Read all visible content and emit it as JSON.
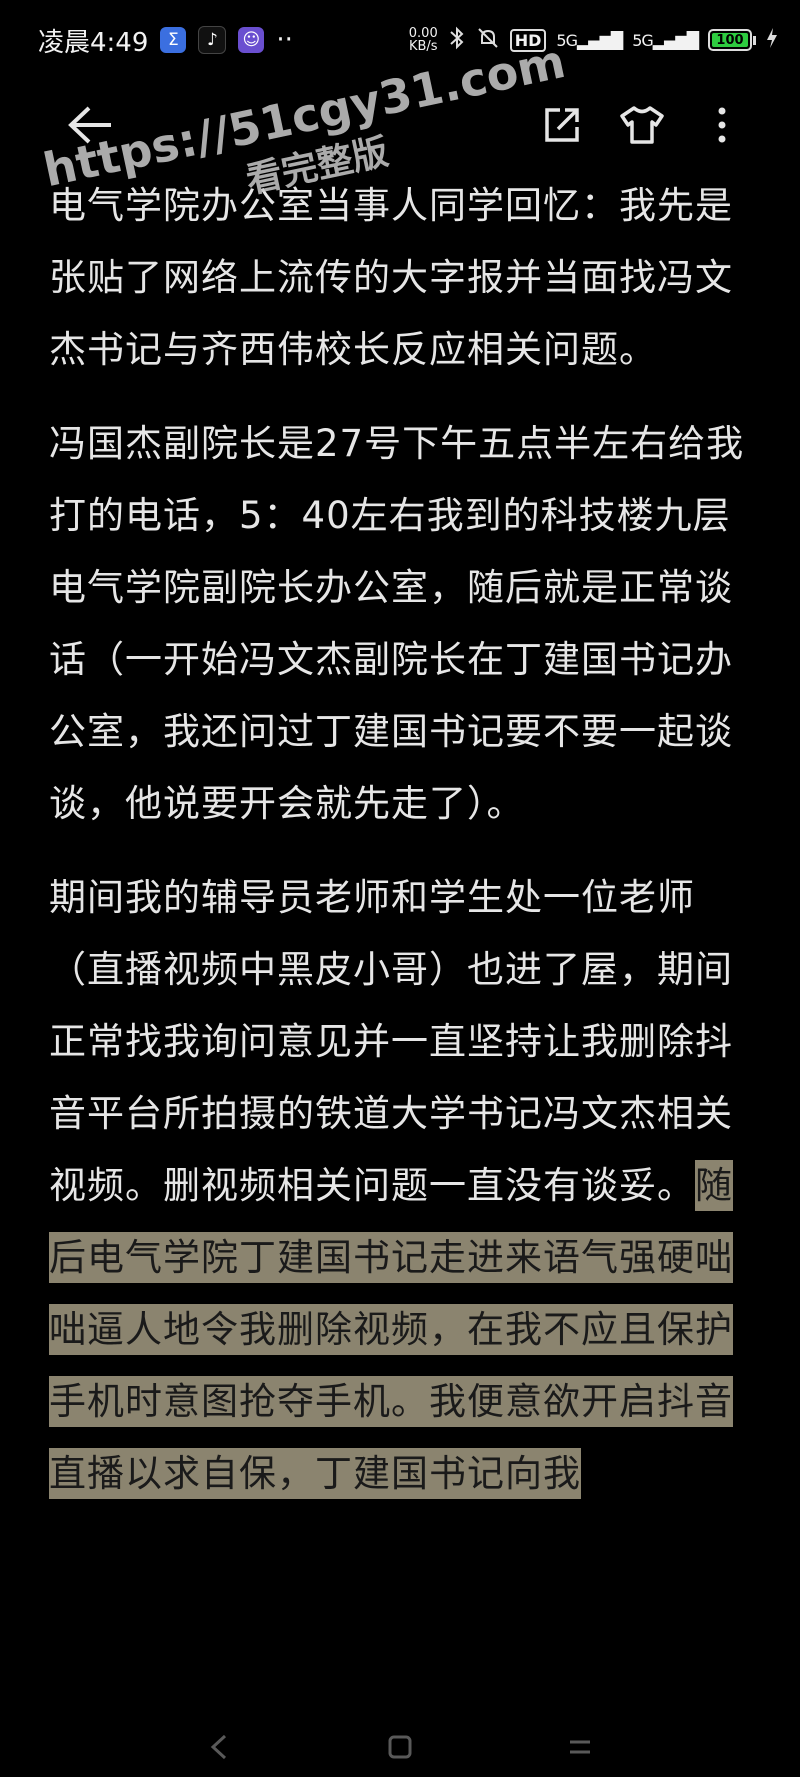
{
  "status_bar": {
    "time": "凌晨4:49",
    "app_icons": [
      "sigma-app-icon",
      "tiktok-icon",
      "app-icon"
    ],
    "more": "··",
    "net_speed_value": "0.00",
    "net_speed_unit": "KB/s",
    "hd_label": "HD",
    "signal1": "5G",
    "signal2": "5G",
    "battery_level": "100",
    "battery_percent": 100
  },
  "toolbar": {
    "back_icon": "back-arrow-icon",
    "share_icon": "share-icon",
    "theme_icon": "tshirt-icon",
    "more_icon": "more-vertical-icon"
  },
  "watermark": {
    "url": "https://51cgy31.com",
    "subtitle": "看完整版"
  },
  "article": {
    "p1": "电气学院办公室当事人同学回忆：我先是张贴了网络上流传的大字报并当面找冯文杰书记与齐西伟校长反应相关问题。",
    "p2": "冯国杰副院长是27号下午五点半左右给我打的电话，5：40左右我到的科技楼九层电气学院副院长办公室，随后就是正常谈话（一开始冯文杰副院长在丁建国书记办公室，我还问过丁建国书记要不要一起谈谈，他说要开会就先走了）。",
    "p3_plain": "期间我的辅导员老师和学生处一位老师（直播视频中黑皮小哥）也进了屋，期间正常找我询问意见并一直坚持让我删除抖音平台所拍摄的铁道大学书记冯文杰相关视频。删视频相关问题一直没有谈妥。",
    "p3_highlight": "随后电气学院丁建国书记走进来语气强硬咄咄逼人地令我删除视频，在我不应且保护手机时意图抢夺手机。我便意欲开启抖音直播以求自保，丁建国书记向我"
  },
  "colors": {
    "background": "#000000",
    "text": "#e6e6e6",
    "highlight": "#8b846f",
    "battery": "#2ecc40"
  }
}
